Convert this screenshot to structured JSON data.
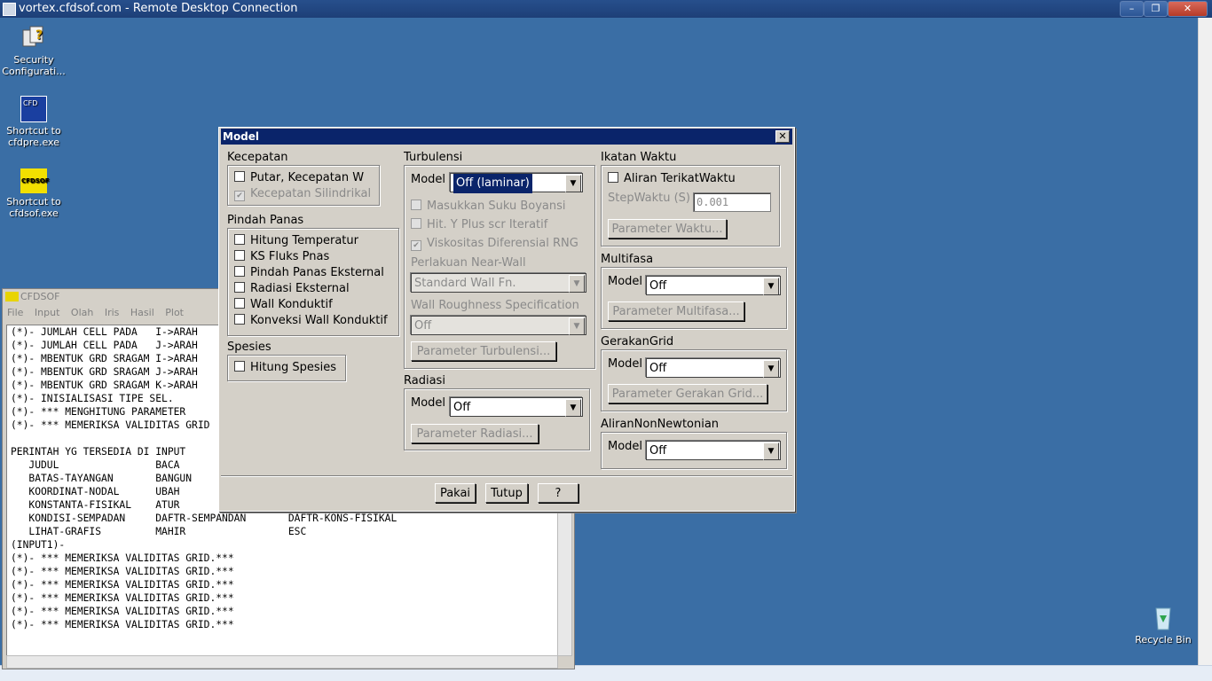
{
  "rdp": {
    "title": "vortex.cfdsof.com - Remote Desktop Connection"
  },
  "desktop": {
    "icons": [
      {
        "label": "Security Configurati..."
      },
      {
        "label": "Shortcut to cfdpre.exe"
      },
      {
        "label": "Shortcut to cfdsof.exe"
      },
      {
        "label": "Recycle Bin"
      }
    ],
    "icon_texts": {
      "cfd": "CFD",
      "cfdsof": "CFDSOF"
    }
  },
  "cfdsof": {
    "title": "CFDSOF",
    "menu": [
      "File",
      "Input",
      "Olah",
      "Iris",
      "Hasil",
      "Plot"
    ],
    "lines": [
      "(*)- JUMLAH CELL PADA   I->ARAH",
      "(*)- JUMLAH CELL PADA   J->ARAH",
      "(*)- MBENTUK GRD SRAGAM I->ARAH",
      "(*)- MBENTUK GRD SRAGAM J->ARAH",
      "(*)- MBENTUK GRD SRAGAM K->ARAH",
      "(*)- INISIALISASI TIPE SEL.",
      "(*)- *** MENGHITUNG PARAMETER",
      "(*)- *** MEMERIKSA VALIDITAS GRID",
      "",
      "PERINTAH YG TERSEDIA DI INPUT",
      "   JUDUL                BACA",
      "   BATAS-TAYANGAN       BANGUN",
      "   KOORDINAT-NODAL      UBAH",
      "   KONSTANTA-FISIKAL    ATUR",
      "   KONDISI-SEMPADAN     DAFTR-SEMPANDAN       DAFTR-KONS-FISIKAL",
      "   LIHAT-GRAFIS         MAHIR                 ESC",
      "(INPUT1)-",
      "(*)- *** MEMERIKSA VALIDITAS GRID.***",
      "(*)- *** MEMERIKSA VALIDITAS GRID.***",
      "(*)- *** MEMERIKSA VALIDITAS GRID.***",
      "(*)- *** MEMERIKSA VALIDITAS GRID.***",
      "(*)- *** MEMERIKSA VALIDITAS GRID.***",
      "(*)- *** MEMERIKSA VALIDITAS GRID.***"
    ]
  },
  "dialog": {
    "title": "Model",
    "kecepatan": {
      "label": "Kecepatan",
      "putar": "Putar, Kecepatan W",
      "silindrikal": "Kecepatan Silindrikal"
    },
    "pindah_panas": {
      "label": "Pindah Panas",
      "items": [
        "Hitung Temperatur",
        "KS Fluks Pnas",
        "Pindah Panas Eksternal",
        "Radiasi Eksternal",
        "Wall Konduktif",
        "Konveksi Wall Konduktif"
      ]
    },
    "spesies": {
      "label": "Spesies",
      "hitung": "Hitung Spesies"
    },
    "turbulensi": {
      "label": "Turbulensi",
      "model_label": "Model",
      "model_value": "Off (laminar)",
      "boyansi": "Masukkan Suku Boyansi",
      "yplus": "Hit. Y Plus scr Iteratif",
      "rng": "Viskositas Diferensial RNG",
      "nearwall_label": "Perlakuan Near-Wall",
      "nearwall_value": "Standard Wall Fn.",
      "roughness_label": "Wall Roughness Specification",
      "roughness_value": "Off",
      "param_button": "Parameter Turbulensi..."
    },
    "radiasi": {
      "label": "Radiasi",
      "model_label": "Model",
      "model_value": "Off",
      "param_button": "Parameter Radiasi..."
    },
    "ikatan_waktu": {
      "label": "Ikatan Waktu",
      "aliran": "Aliran TerikatWaktu",
      "step_label": "StepWaktu (S)",
      "step_value": "0.001",
      "param_button": "Parameter Waktu..."
    },
    "multifasa": {
      "label": "Multifasa",
      "model_label": "Model",
      "model_value": "Off",
      "param_button": "Parameter Multifasa..."
    },
    "gerakan_grid": {
      "label": "GerakanGrid",
      "model_label": "Model",
      "model_value": "Off",
      "param_button": "Parameter Gerakan Grid..."
    },
    "non_newtonian": {
      "label": "AliranNonNewtonian",
      "model_label": "Model",
      "model_value": "Off"
    },
    "buttons": {
      "pakai": "Pakai",
      "tutup": "Tutup",
      "help": "?"
    },
    "checkmark": "✔",
    "close_glyph": "✕"
  },
  "colors": {
    "desktop": "#3a6ea5",
    "titlebar": "#0a246a",
    "dialog": "#d4d0c8"
  }
}
